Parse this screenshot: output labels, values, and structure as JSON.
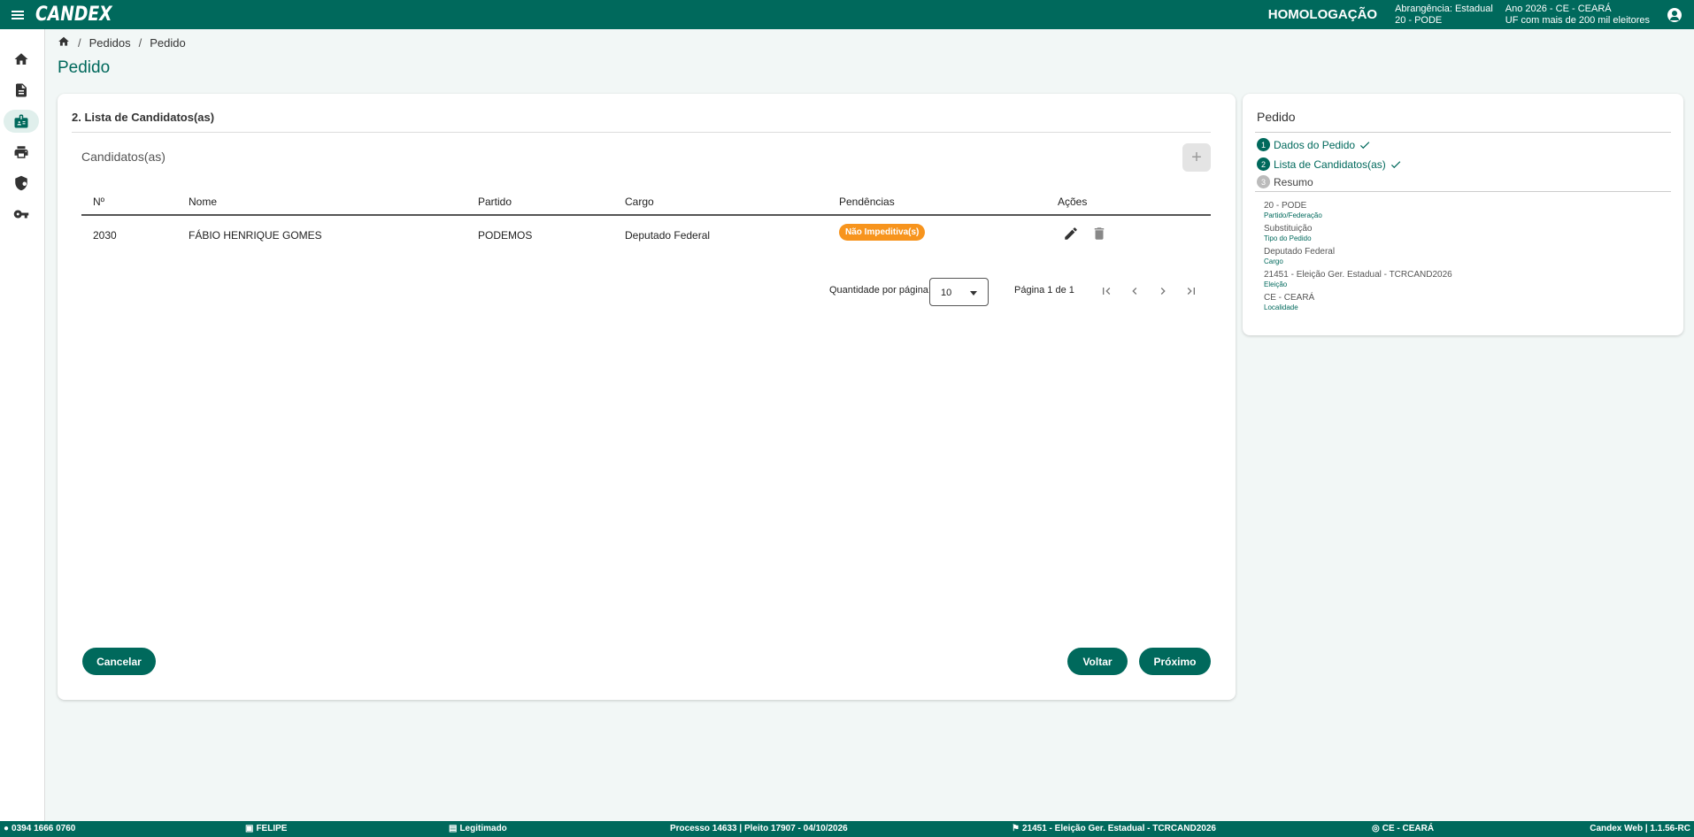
{
  "app": {
    "logo": "CANDEX",
    "environment": "HOMOLOGAÇÃO",
    "abrangencia": "Abrangência: Estadual",
    "partido": "20 - PODE",
    "ano": "Ano 2026 - CE - CEARÁ",
    "uf_info": "UF com mais de 200 mil eleitores"
  },
  "sidebar": {
    "items": [
      {
        "name": "home",
        "icon": "home-icon"
      },
      {
        "name": "documents",
        "icon": "document-icon"
      },
      {
        "name": "candidates",
        "icon": "id-badge-icon",
        "active": true
      },
      {
        "name": "print",
        "icon": "printer-icon"
      },
      {
        "name": "security",
        "icon": "shield-icon"
      },
      {
        "name": "keys",
        "icon": "key-icon"
      }
    ]
  },
  "breadcrumb": {
    "items": [
      "Pedidos",
      "Pedido"
    ]
  },
  "page": {
    "title": "Pedido"
  },
  "main": {
    "section_title": "2. Lista de Candidatos(as)",
    "subtitle": "Candidatos(as)",
    "add_label": "+",
    "columns": [
      "Nº",
      "Nome",
      "Partido",
      "Cargo",
      "Pendências",
      "Ações"
    ],
    "rows": [
      {
        "numero": "2030",
        "nome": "FÁBIO HENRIQUE GOMES",
        "partido": "PODEMOS",
        "cargo": "Deputado Federal",
        "pendencia": "Não Impeditiva(s)"
      }
    ],
    "pagination": {
      "per_page_label": "Quantidade por página:",
      "per_page_value": "10",
      "page_info": "Página 1 de 1"
    },
    "buttons": {
      "cancel": "Cancelar",
      "back": "Voltar",
      "next": "Próximo"
    }
  },
  "summary": {
    "title": "Pedido",
    "steps": [
      {
        "num": "1",
        "label": "Dados do Pedido",
        "status": "done"
      },
      {
        "num": "2",
        "label": "Lista de Candidatos(as)",
        "status": "done"
      },
      {
        "num": "3",
        "label": "Resumo",
        "status": "pending"
      }
    ],
    "details": [
      {
        "value": "20 - PODE",
        "key": "Partido/Federação"
      },
      {
        "value": "Substituição",
        "key": "Tipo do Pedido"
      },
      {
        "value": "Deputado Federal",
        "key": "Cargo"
      },
      {
        "value": "21451 - Eleição Ger. Estadual - TCRCAND2026",
        "key": "Eleição"
      },
      {
        "value": "CE - CEARÁ",
        "key": "Localidade"
      }
    ]
  },
  "footer": {
    "cpf": "0394 1666 0760",
    "user": "FELIPE",
    "role": "Legitimado",
    "processo": "Processo 14633 | Pleito 17907 - 04/10/2026",
    "eleicao": "21451 - Eleição Ger. Estadual - TCRCAND2026",
    "uf": "CE - CEARÁ",
    "version": "Candex Web | 1.1.56-RC"
  },
  "colors": {
    "primary": "#00695c",
    "badge": "#f7941d",
    "background": "#f2f7f6"
  }
}
